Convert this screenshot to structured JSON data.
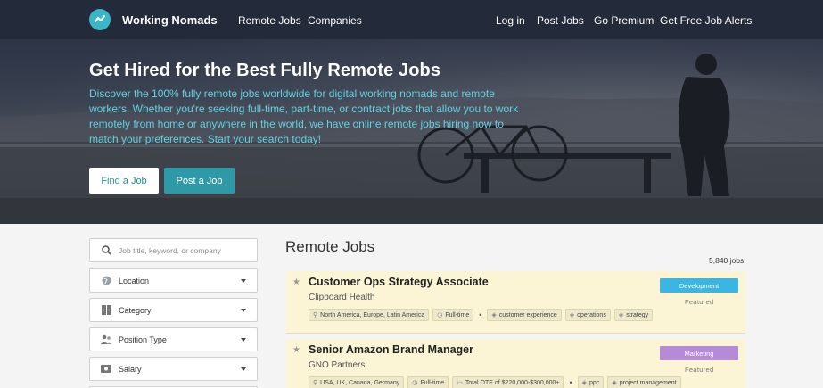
{
  "header": {
    "brand": "Working Nomads",
    "nav_left": [
      "Remote Jobs",
      "Companies"
    ],
    "nav_right": [
      "Log in",
      "Post Jobs",
      "Go Premium",
      "Get Free Job Alerts"
    ]
  },
  "hero": {
    "title": "Get Hired for the Best Fully Remote Jobs",
    "description": "Discover the 100% fully remote jobs worldwide for digital working nomads and remote workers. Whether you're seeking full-time, part-time, or contract jobs that allow you to work remotely from home or anywhere in the world, we have online remote jobs hiring now to match your preferences. Start your search today!",
    "find_button": "Find a Job",
    "post_button": "Post a Job"
  },
  "filters": {
    "search_placeholder": "Job title, keyword, or company",
    "location": "Location",
    "category": "Category",
    "position_type": "Position Type",
    "salary": "Salary"
  },
  "listing": {
    "title": "Remote Jobs",
    "count": "5,840 jobs",
    "jobs": [
      {
        "title": "Customer Ops Strategy Associate",
        "company": "Clipboard Health",
        "category": "Development",
        "category_color": "#3bb6e3",
        "featured": "Featured",
        "location": "North America, Europe, Latin America",
        "type": "Full-time",
        "tags": [
          "customer experience",
          "operations",
          "strategy"
        ]
      },
      {
        "title": "Senior Amazon Brand Manager",
        "company": "GNO Partners",
        "category": "Marketing",
        "category_color": "#b58ad6",
        "featured": "Featured",
        "location": "USA, UK, Canada, Germany",
        "type": "Full-time",
        "salary": "Total OTE of $220,000-$300,000+",
        "tags": [
          "ppc",
          "project management"
        ]
      }
    ]
  },
  "colors": {
    "header_bg": "#232b3a",
    "accent": "#3bb6c6",
    "hero_text": "#5fd3e0",
    "job_bg": "#fbf5d6"
  }
}
